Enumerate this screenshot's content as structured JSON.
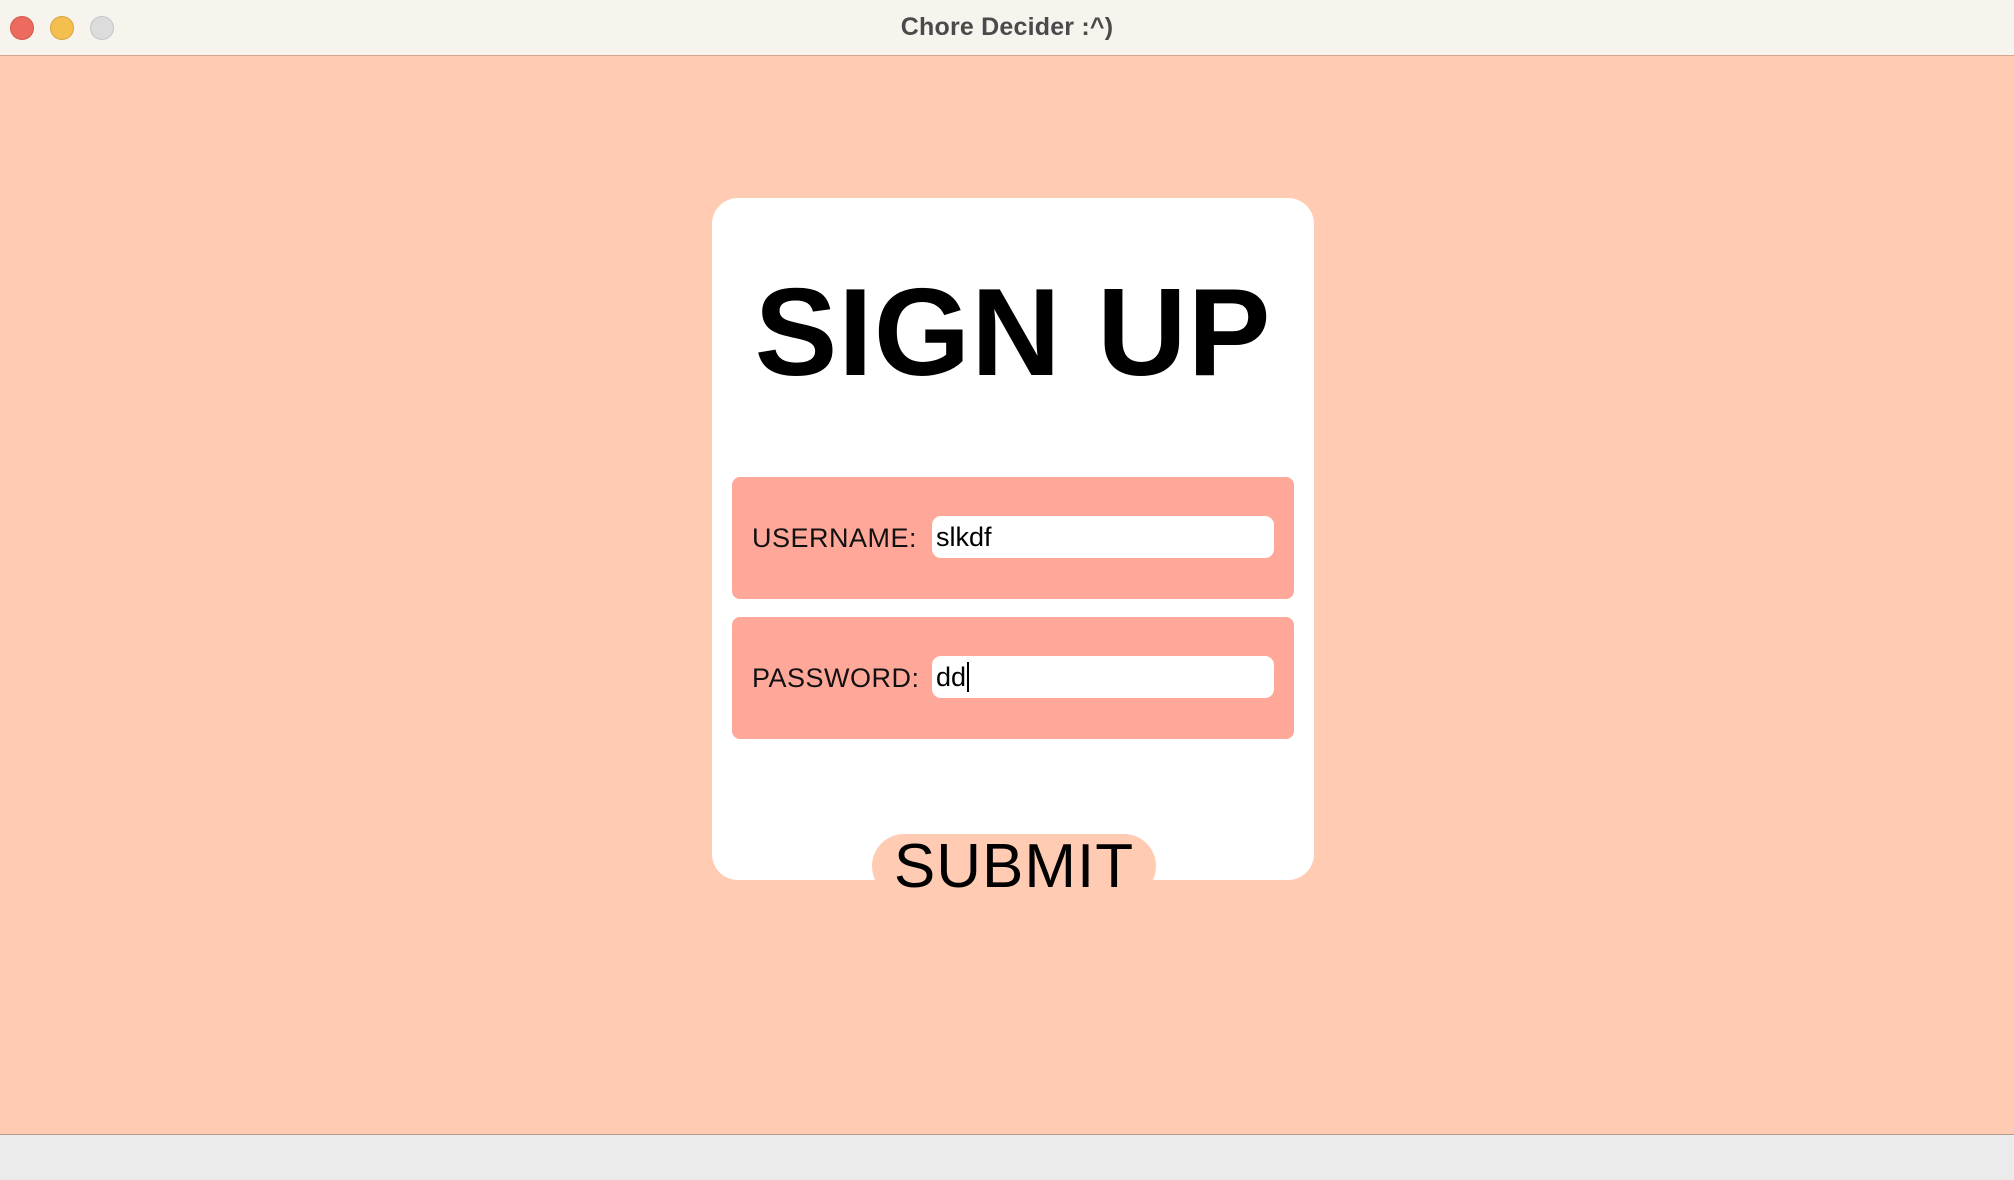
{
  "window": {
    "title": "Chore Decider :^)"
  },
  "form": {
    "heading": "SIGN UP",
    "username": {
      "label": "USERNAME:",
      "value": "slkdf"
    },
    "password": {
      "label": "PASSWORD:",
      "value": "dd"
    },
    "submit_label": "SUBMIT"
  },
  "colors": {
    "background": "#ffccb3",
    "card": "#ffffff",
    "field_row": "#ffa89a",
    "submit_button": "#ffccb3",
    "titlebar": "#f7f4ee"
  }
}
